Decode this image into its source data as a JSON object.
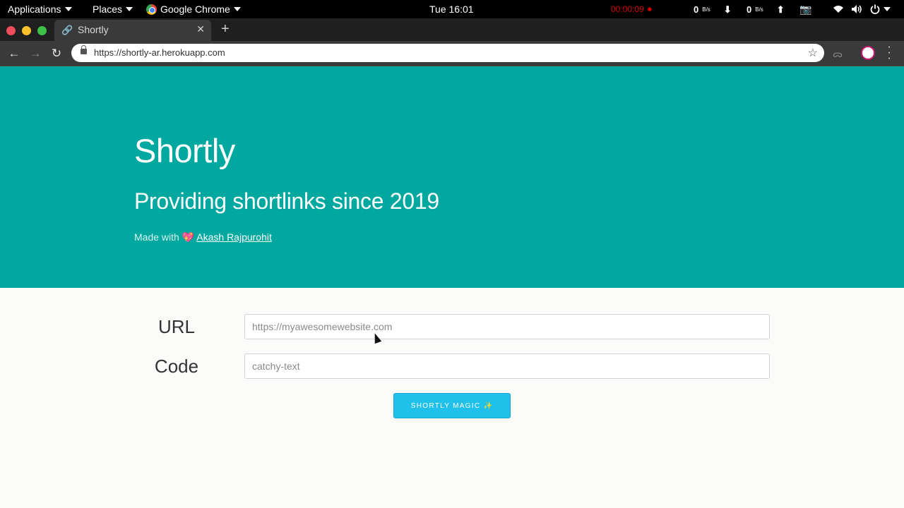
{
  "os": {
    "applications_label": "Applications",
    "places_label": "Places",
    "active_app_label": "Google Chrome",
    "clock": "Tue 16:01",
    "recording_time": "00:00:09",
    "net_down_value": "0",
    "net_down_unit": "B/s",
    "net_up_value": "0",
    "net_up_unit": "B/s"
  },
  "browser": {
    "tab_title": "Shortly",
    "address": "https://shortly-ar.herokuapp.com"
  },
  "hero": {
    "title": "Shortly",
    "subtitle": "Providing shortlinks since 2019",
    "made_with": "Made with",
    "author": "Akash Rajpurohit"
  },
  "form": {
    "url_label": "URL",
    "url_placeholder": "https://myawesomewebsite.com",
    "code_label": "Code",
    "code_placeholder": "catchy-text",
    "submit_label": "SHORTLY MAGIC ✨"
  },
  "colors": {
    "hero_bg": "#00a89f",
    "button_bg": "#1fc1ea",
    "page_bg": "#fbfbfa"
  }
}
